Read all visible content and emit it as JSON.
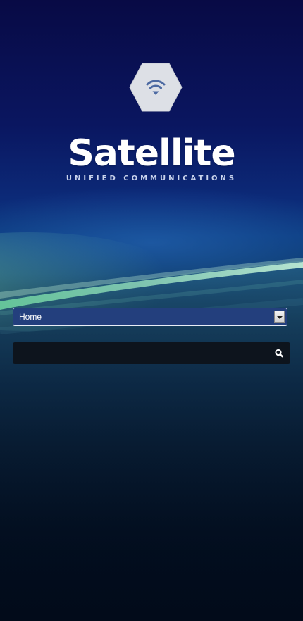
{
  "brand": {
    "name": "Satellite",
    "tagline": "UNIFIED COMMUNICATIONS",
    "logo_icon": "wifi-signal-icon"
  },
  "navigation": {
    "select_value": "Home"
  },
  "search": {
    "value": "",
    "placeholder": "",
    "button_icon": "search-icon"
  },
  "colors": {
    "sky_top": "#080a45",
    "horizon_glow": "#7fe3b0",
    "select_bg": "#233f7d",
    "search_bg": "#0d141d"
  }
}
